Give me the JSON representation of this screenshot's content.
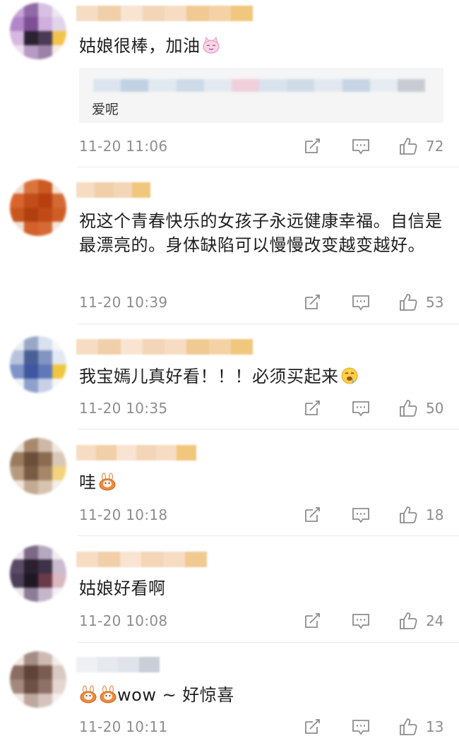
{
  "comments": [
    {
      "text": "姑娘很棒，加油",
      "emoji": "cat-emoji",
      "quote_text": "爱呢",
      "time": "11-20 11:06",
      "likes": "72"
    },
    {
      "text": "祝这个青春快乐的女孩子永远健康幸福。自信是最漂亮的。身体缺陷可以慢慢改变越变越好。",
      "time": "11-20 10:39",
      "likes": "53"
    },
    {
      "text": "我宝嫣儿真好看！！！必须买起来",
      "emoji": "drool-face-emoji",
      "time": "11-20 10:35",
      "likes": "50"
    },
    {
      "text": "哇",
      "emoji": "bunny-emoji",
      "time": "11-20 10:18",
      "likes": "18"
    },
    {
      "text": "姑娘好看啊",
      "time": "11-20 10:08",
      "likes": "24"
    },
    {
      "text": "wow ~ 好惊喜",
      "emoji": "bunny-emoji",
      "time": "11-20 10:11",
      "likes": "13"
    }
  ],
  "icons": {
    "repost": "repost-icon",
    "reply": "reply-icon",
    "like": "thumbs-up-icon"
  },
  "colors": {
    "text": "#1f1f1f",
    "meta": "#8d8d8d",
    "quote_bg": "#f5f5f5"
  }
}
